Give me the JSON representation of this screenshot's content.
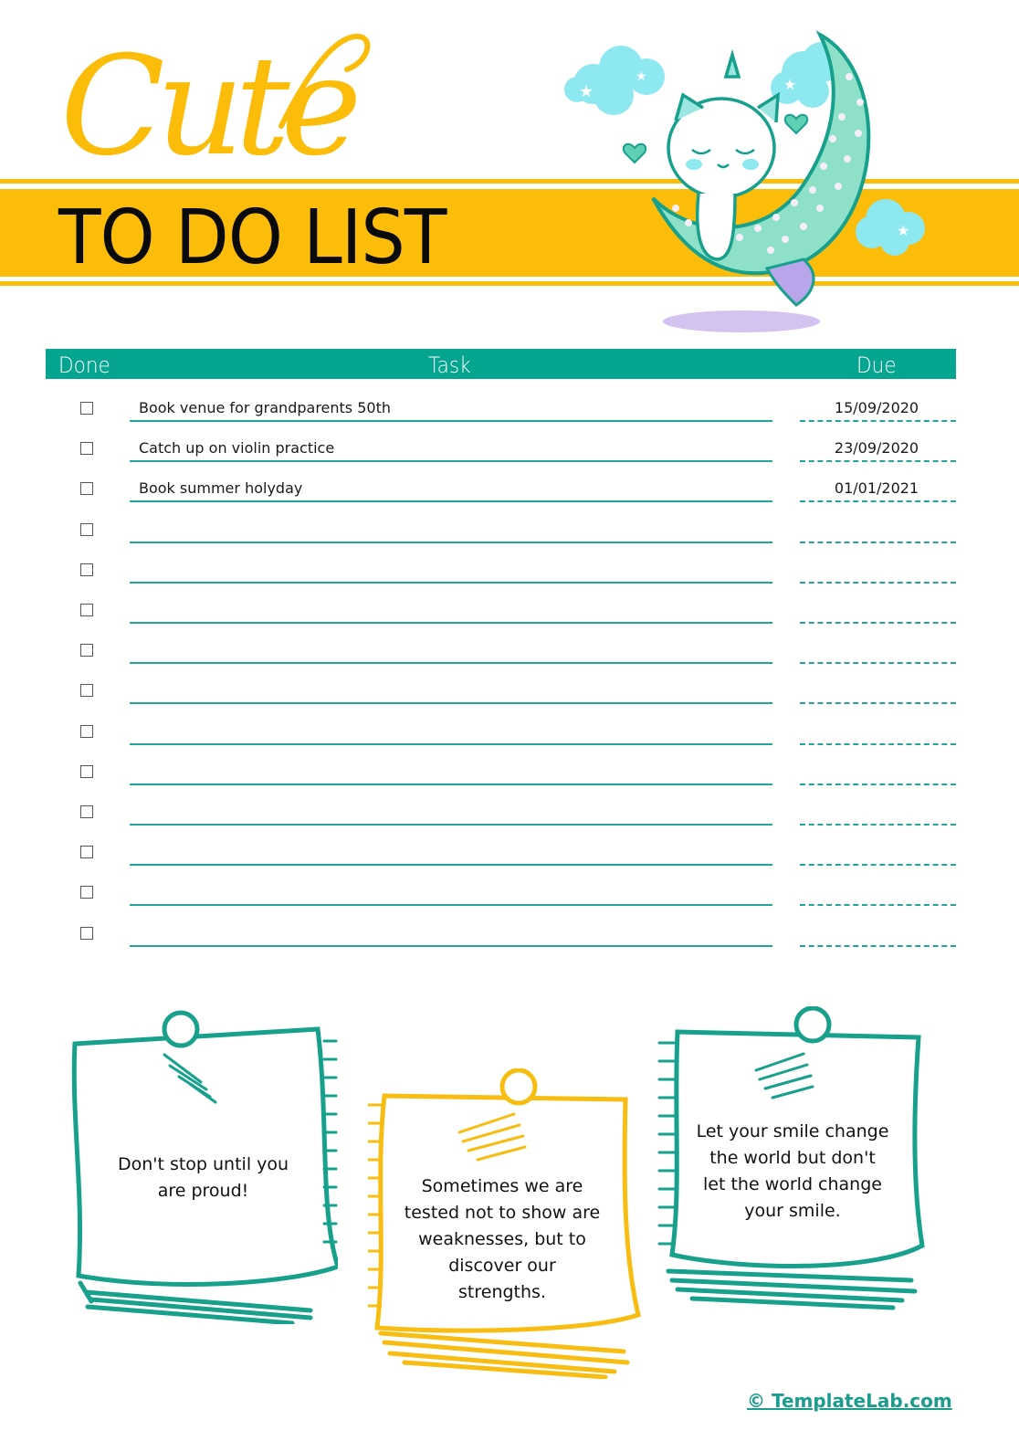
{
  "header": {
    "script_title": "Cute",
    "title": "TO DO LIST"
  },
  "colors": {
    "yellow": "#fbbc0a",
    "teal": "#06a590",
    "line_teal": "#22a598",
    "cloud": "#8ee8ef",
    "moon": "#8fe0c9",
    "shadow": "#d4c2f0"
  },
  "table": {
    "columns": {
      "done": "Done",
      "task": "Task",
      "due": "Due"
    },
    "rows": [
      {
        "done": false,
        "task": "Book venue for grandparents 50th",
        "due": "15/09/2020"
      },
      {
        "done": false,
        "task": "Catch up on violin practice",
        "due": "23/09/2020"
      },
      {
        "done": false,
        "task": "Book summer holyday",
        "due": "01/01/2021"
      },
      {
        "done": false,
        "task": "",
        "due": ""
      },
      {
        "done": false,
        "task": "",
        "due": ""
      },
      {
        "done": false,
        "task": "",
        "due": ""
      },
      {
        "done": false,
        "task": "",
        "due": ""
      },
      {
        "done": false,
        "task": "",
        "due": ""
      },
      {
        "done": false,
        "task": "",
        "due": ""
      },
      {
        "done": false,
        "task": "",
        "due": ""
      },
      {
        "done": false,
        "task": "",
        "due": ""
      },
      {
        "done": false,
        "task": "",
        "due": ""
      },
      {
        "done": false,
        "task": "",
        "due": ""
      },
      {
        "done": false,
        "task": "",
        "due": ""
      }
    ]
  },
  "notes": [
    {
      "color": "teal",
      "lines": [
        "Don't stop until you",
        "are proud!"
      ]
    },
    {
      "color": "yellow",
      "lines": [
        "Sometimes we are",
        "tested not to show are",
        "weaknesses, but to",
        "discover our",
        "strengths."
      ]
    },
    {
      "color": "teal",
      "lines": [
        "Let your smile change",
        "the world but don't",
        "let the world change",
        "your smile."
      ]
    }
  ],
  "footer": {
    "copyright": "© TemplateLab.com"
  }
}
